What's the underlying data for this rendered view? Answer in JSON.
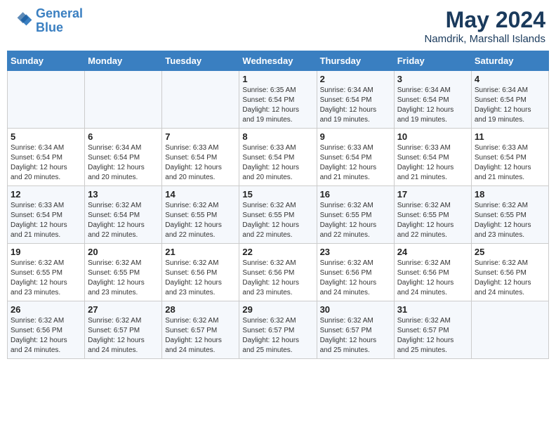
{
  "header": {
    "logo_line1": "General",
    "logo_line2": "Blue",
    "month_year": "May 2024",
    "location": "Namdrik, Marshall Islands"
  },
  "weekdays": [
    "Sunday",
    "Monday",
    "Tuesday",
    "Wednesday",
    "Thursday",
    "Friday",
    "Saturday"
  ],
  "weeks": [
    [
      {
        "day": "",
        "info": ""
      },
      {
        "day": "",
        "info": ""
      },
      {
        "day": "",
        "info": ""
      },
      {
        "day": "1",
        "info": "Sunrise: 6:35 AM\nSunset: 6:54 PM\nDaylight: 12 hours\nand 19 minutes."
      },
      {
        "day": "2",
        "info": "Sunrise: 6:34 AM\nSunset: 6:54 PM\nDaylight: 12 hours\nand 19 minutes."
      },
      {
        "day": "3",
        "info": "Sunrise: 6:34 AM\nSunset: 6:54 PM\nDaylight: 12 hours\nand 19 minutes."
      },
      {
        "day": "4",
        "info": "Sunrise: 6:34 AM\nSunset: 6:54 PM\nDaylight: 12 hours\nand 19 minutes."
      }
    ],
    [
      {
        "day": "5",
        "info": "Sunrise: 6:34 AM\nSunset: 6:54 PM\nDaylight: 12 hours\nand 20 minutes."
      },
      {
        "day": "6",
        "info": "Sunrise: 6:34 AM\nSunset: 6:54 PM\nDaylight: 12 hours\nand 20 minutes."
      },
      {
        "day": "7",
        "info": "Sunrise: 6:33 AM\nSunset: 6:54 PM\nDaylight: 12 hours\nand 20 minutes."
      },
      {
        "day": "8",
        "info": "Sunrise: 6:33 AM\nSunset: 6:54 PM\nDaylight: 12 hours\nand 20 minutes."
      },
      {
        "day": "9",
        "info": "Sunrise: 6:33 AM\nSunset: 6:54 PM\nDaylight: 12 hours\nand 21 minutes."
      },
      {
        "day": "10",
        "info": "Sunrise: 6:33 AM\nSunset: 6:54 PM\nDaylight: 12 hours\nand 21 minutes."
      },
      {
        "day": "11",
        "info": "Sunrise: 6:33 AM\nSunset: 6:54 PM\nDaylight: 12 hours\nand 21 minutes."
      }
    ],
    [
      {
        "day": "12",
        "info": "Sunrise: 6:33 AM\nSunset: 6:54 PM\nDaylight: 12 hours\nand 21 minutes."
      },
      {
        "day": "13",
        "info": "Sunrise: 6:32 AM\nSunset: 6:54 PM\nDaylight: 12 hours\nand 22 minutes."
      },
      {
        "day": "14",
        "info": "Sunrise: 6:32 AM\nSunset: 6:55 PM\nDaylight: 12 hours\nand 22 minutes."
      },
      {
        "day": "15",
        "info": "Sunrise: 6:32 AM\nSunset: 6:55 PM\nDaylight: 12 hours\nand 22 minutes."
      },
      {
        "day": "16",
        "info": "Sunrise: 6:32 AM\nSunset: 6:55 PM\nDaylight: 12 hours\nand 22 minutes."
      },
      {
        "day": "17",
        "info": "Sunrise: 6:32 AM\nSunset: 6:55 PM\nDaylight: 12 hours\nand 22 minutes."
      },
      {
        "day": "18",
        "info": "Sunrise: 6:32 AM\nSunset: 6:55 PM\nDaylight: 12 hours\nand 23 minutes."
      }
    ],
    [
      {
        "day": "19",
        "info": "Sunrise: 6:32 AM\nSunset: 6:55 PM\nDaylight: 12 hours\nand 23 minutes."
      },
      {
        "day": "20",
        "info": "Sunrise: 6:32 AM\nSunset: 6:55 PM\nDaylight: 12 hours\nand 23 minutes."
      },
      {
        "day": "21",
        "info": "Sunrise: 6:32 AM\nSunset: 6:56 PM\nDaylight: 12 hours\nand 23 minutes."
      },
      {
        "day": "22",
        "info": "Sunrise: 6:32 AM\nSunset: 6:56 PM\nDaylight: 12 hours\nand 23 minutes."
      },
      {
        "day": "23",
        "info": "Sunrise: 6:32 AM\nSunset: 6:56 PM\nDaylight: 12 hours\nand 24 minutes."
      },
      {
        "day": "24",
        "info": "Sunrise: 6:32 AM\nSunset: 6:56 PM\nDaylight: 12 hours\nand 24 minutes."
      },
      {
        "day": "25",
        "info": "Sunrise: 6:32 AM\nSunset: 6:56 PM\nDaylight: 12 hours\nand 24 minutes."
      }
    ],
    [
      {
        "day": "26",
        "info": "Sunrise: 6:32 AM\nSunset: 6:56 PM\nDaylight: 12 hours\nand 24 minutes."
      },
      {
        "day": "27",
        "info": "Sunrise: 6:32 AM\nSunset: 6:57 PM\nDaylight: 12 hours\nand 24 minutes."
      },
      {
        "day": "28",
        "info": "Sunrise: 6:32 AM\nSunset: 6:57 PM\nDaylight: 12 hours\nand 24 minutes."
      },
      {
        "day": "29",
        "info": "Sunrise: 6:32 AM\nSunset: 6:57 PM\nDaylight: 12 hours\nand 25 minutes."
      },
      {
        "day": "30",
        "info": "Sunrise: 6:32 AM\nSunset: 6:57 PM\nDaylight: 12 hours\nand 25 minutes."
      },
      {
        "day": "31",
        "info": "Sunrise: 6:32 AM\nSunset: 6:57 PM\nDaylight: 12 hours\nand 25 minutes."
      },
      {
        "day": "",
        "info": ""
      }
    ]
  ]
}
